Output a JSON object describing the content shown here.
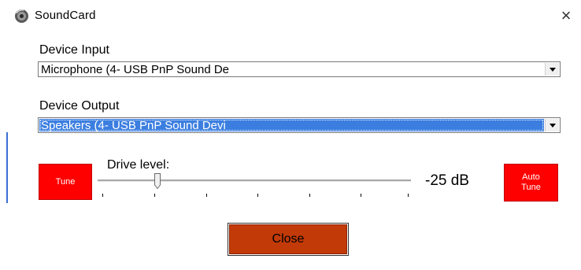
{
  "window": {
    "title": "SoundCard",
    "close_glyph": "×",
    "icon": "speaker-icon"
  },
  "input": {
    "label": "Device Input",
    "selected": "Microphone (4- USB PnP Sound De"
  },
  "output": {
    "label": "Device Output",
    "selected": "Speakers (4- USB PnP Sound Devi"
  },
  "drive": {
    "label": "Drive level:",
    "readout": "-25 dB",
    "slider_fraction": 0.19
  },
  "buttons": {
    "tune": "Tune",
    "auto_tune_line1": "Auto",
    "auto_tune_line2": "Tune",
    "close": "Close"
  },
  "colors": {
    "tune_red": "#ff0000",
    "close_orange": "#c23a08",
    "selection_blue": "#3b7ee0"
  }
}
